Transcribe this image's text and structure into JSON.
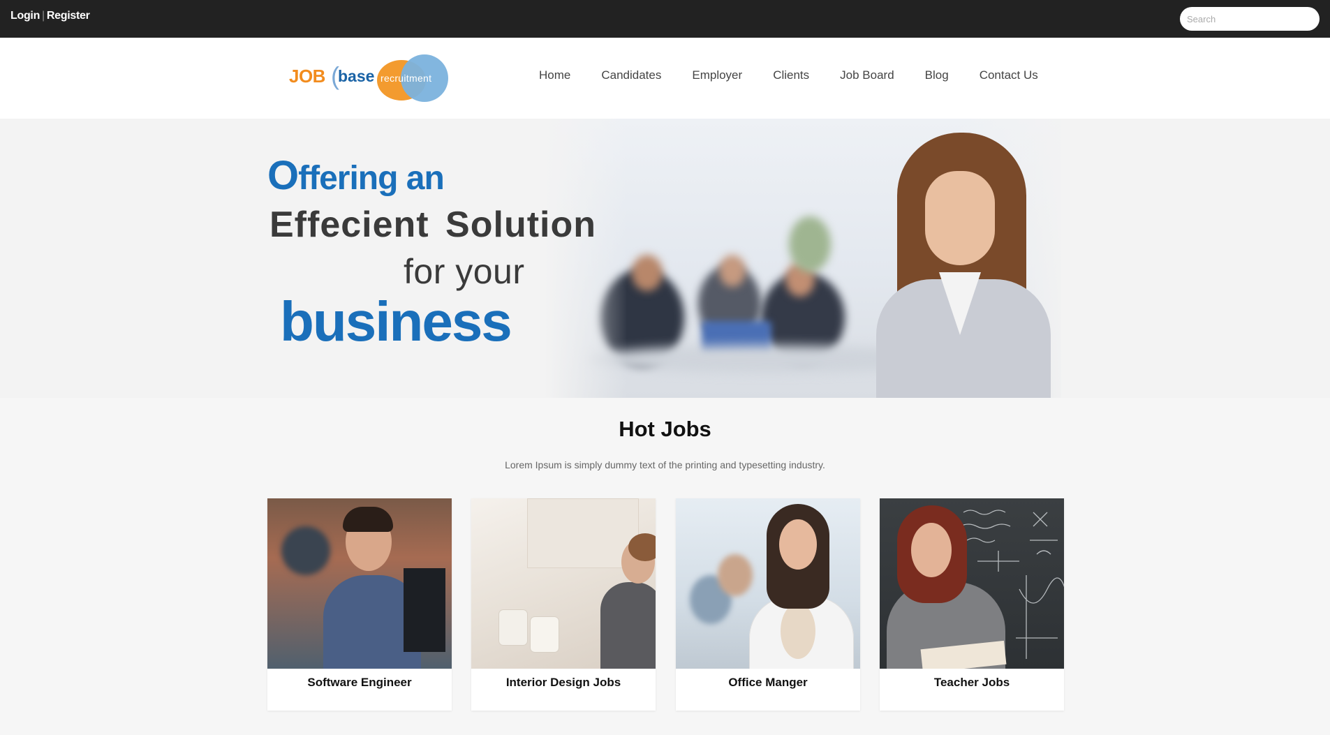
{
  "topbar": {
    "login_label": "Login",
    "separator": "|",
    "register_label": "Register",
    "search_placeholder": "Search"
  },
  "logo": {
    "part_job": "JOB",
    "part_paren": "(",
    "part_base": "base",
    "part_recruitment": "recruitment",
    "colors": {
      "orange": "#f28c1e",
      "blue": "#1a63a6",
      "light_blue": "#7bb2dd"
    }
  },
  "nav": {
    "items": [
      {
        "label": "Home"
      },
      {
        "label": "Candidates"
      },
      {
        "label": "Employer"
      },
      {
        "label": "Clients"
      },
      {
        "label": "Job Board"
      },
      {
        "label": "Blog"
      },
      {
        "label": "Contact Us"
      }
    ]
  },
  "hero": {
    "line1_first_letter": "O",
    "line1_rest": "ffering an",
    "line2": "Effecient  Solution",
    "line3": "for your",
    "line4": "business",
    "accent_color": "#1a6fba"
  },
  "hot_jobs": {
    "title": "Hot Jobs",
    "subtitle": "Lorem Ipsum is simply dummy text of the printing and typesetting industry.",
    "cards": [
      {
        "label": "Software Engineer"
      },
      {
        "label": "Interior Design Jobs"
      },
      {
        "label": "Office Manger"
      },
      {
        "label": "Teacher Jobs"
      }
    ]
  }
}
